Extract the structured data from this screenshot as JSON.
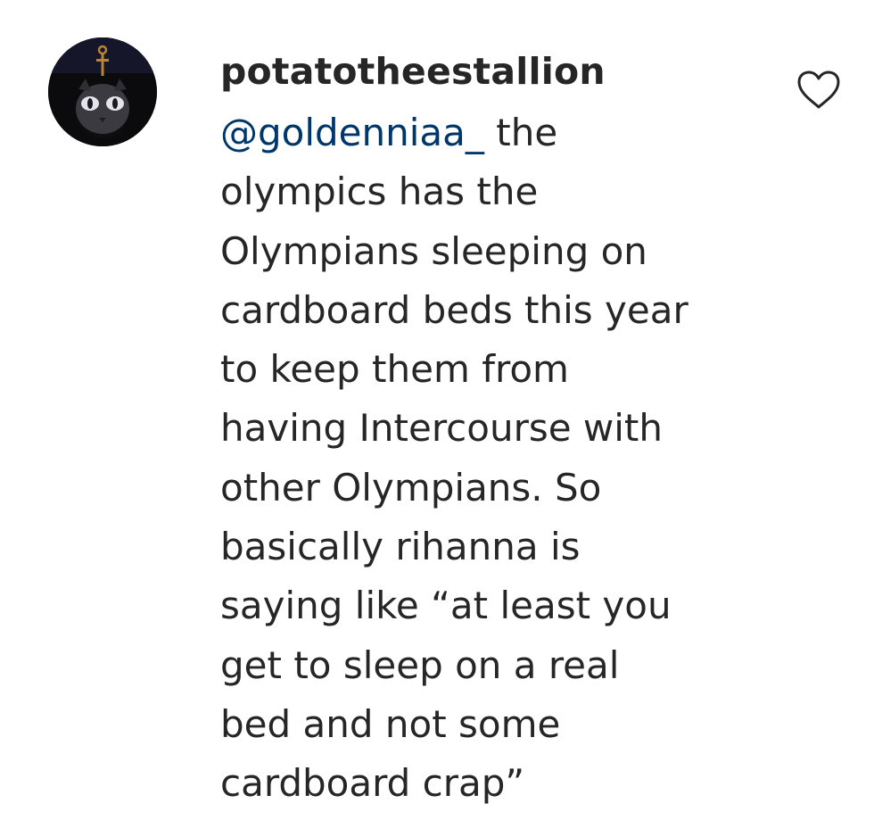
{
  "comment": {
    "username": "potatotheestallion",
    "mention": "@goldenniaa_",
    "first_line_rest": " the",
    "lines": [
      "olympics has the",
      "Olympians sleeping on",
      "cardboard beds this year",
      "to keep them from",
      "having Intercourse with",
      "other Olympians. So",
      "basically rihanna is",
      "saying like “at least you",
      "get to sleep on a real",
      "bed and not some",
      "cardboard crap”"
    ]
  },
  "icons": {
    "avatar": "profile-avatar-dark",
    "like": "heart-outline-icon"
  },
  "colors": {
    "text": "#262626",
    "mention": "#00376b",
    "background": "#ffffff"
  }
}
